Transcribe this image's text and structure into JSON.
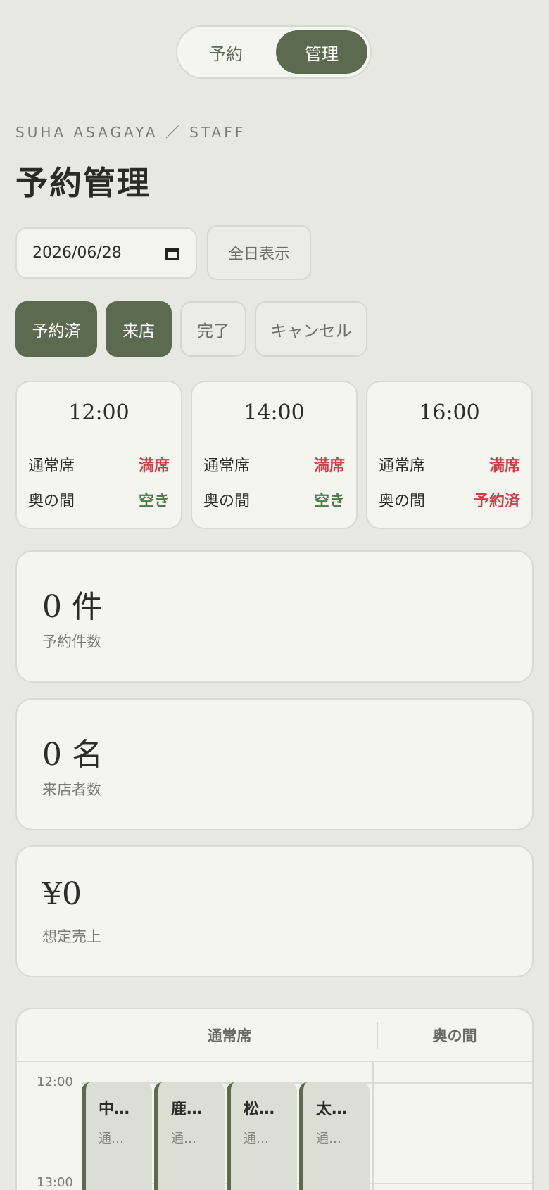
{
  "mode_toggle": {
    "reserve": "予約",
    "manage": "管理"
  },
  "eyebrow": "SUHA ASAGAYA ／ STAFF",
  "title": "予約管理",
  "date": "2026/06/28",
  "allday_label": "全日表示",
  "filters": [
    {
      "label": "予約済",
      "active": true
    },
    {
      "label": "来店",
      "active": true
    },
    {
      "label": "完了",
      "active": false
    },
    {
      "label": "キャンセル",
      "active": false
    }
  ],
  "slots": [
    {
      "time": "12:00",
      "rows": [
        {
          "seat": "通常席",
          "status": "満席"
        },
        {
          "seat": "奥の間",
          "status": "空き"
        }
      ]
    },
    {
      "time": "14:00",
      "rows": [
        {
          "seat": "通常席",
          "status": "満席"
        },
        {
          "seat": "奥の間",
          "status": "空き"
        }
      ]
    },
    {
      "time": "16:00",
      "rows": [
        {
          "seat": "通常席",
          "status": "満席"
        },
        {
          "seat": "奥の間",
          "status": "予約済"
        }
      ]
    }
  ],
  "stats": {
    "reservations": {
      "value": "0 件",
      "label": "予約件数"
    },
    "visitors": {
      "value": "0 名",
      "label": "来店者数"
    },
    "sales": {
      "value": "¥0",
      "label": "想定売上"
    }
  },
  "schedule": {
    "col_main": "通常席",
    "col_back": "奥の間",
    "times": [
      "12:00",
      "13:00"
    ],
    "bookings": [
      {
        "name": "中…",
        "seat": "通…"
      },
      {
        "name": "鹿…",
        "seat": "通…"
      },
      {
        "name": "松…",
        "seat": "通…"
      },
      {
        "name": "太…",
        "seat": "通…"
      }
    ]
  },
  "colors": {
    "accent": "#5c6b50",
    "full": "#c8424a",
    "free": "#4a7a4a",
    "background": "#e8e8e2"
  }
}
